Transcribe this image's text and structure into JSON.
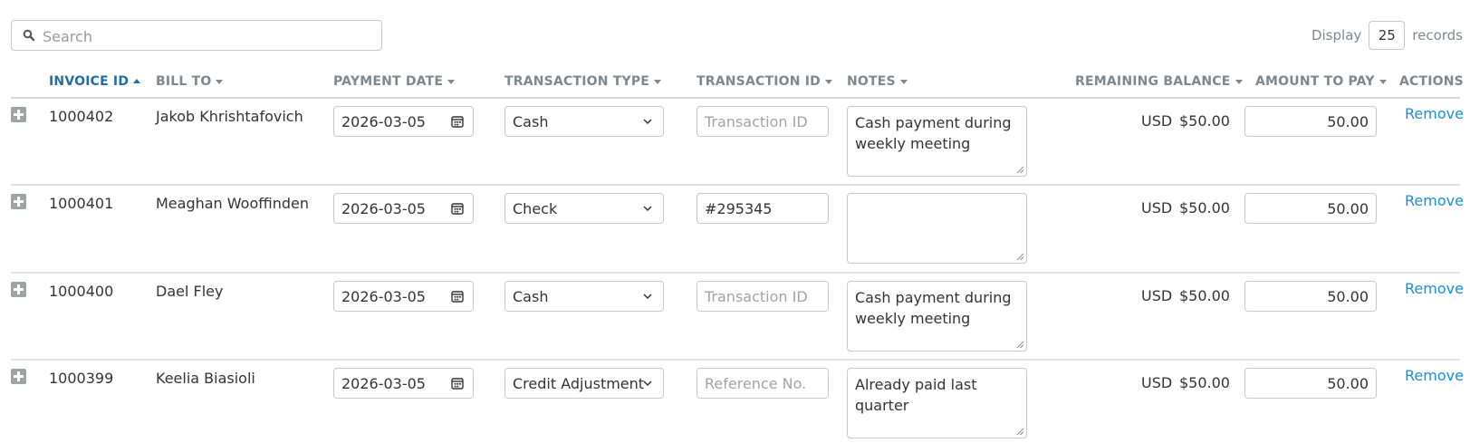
{
  "search": {
    "placeholder": "Search",
    "value": ""
  },
  "display": {
    "prefix": "Display",
    "count": "25",
    "suffix": "records"
  },
  "columns": {
    "invoice_id": "INVOICE ID",
    "bill_to": "BILL TO",
    "payment_date": "PAYMENT DATE",
    "transaction_type": "TRANSACTION TYPE",
    "transaction_id": "TRANSACTION ID",
    "notes": "NOTES",
    "remaining_balance": "REMAINING BALANCE",
    "amount_to_pay": "AMOUNT TO PAY",
    "actions": "ACTIONS"
  },
  "rows": [
    {
      "invoice_id": "1000402",
      "bill_to": "Jakob Khrishtafovich",
      "payment_date": "2026-03-05",
      "transaction_type": "Cash",
      "transaction_id": "",
      "transaction_id_placeholder": "Transaction ID",
      "notes": "Cash payment during weekly meeting",
      "currency": "USD",
      "remaining_balance": "$50.00",
      "amount_to_pay": "50.00",
      "action": "Remove"
    },
    {
      "invoice_id": "1000401",
      "bill_to": "Meaghan Wooffinden",
      "payment_date": "2026-03-05",
      "transaction_type": "Check",
      "transaction_id": "#295345",
      "transaction_id_placeholder": "",
      "notes": "",
      "currency": "USD",
      "remaining_balance": "$50.00",
      "amount_to_pay": "50.00",
      "action": "Remove"
    },
    {
      "invoice_id": "1000400",
      "bill_to": "Dael Fley",
      "payment_date": "2026-03-05",
      "transaction_type": "Cash",
      "transaction_id": "",
      "transaction_id_placeholder": "Transaction ID",
      "notes": "Cash payment during weekly meeting",
      "currency": "USD",
      "remaining_balance": "$50.00",
      "amount_to_pay": "50.00",
      "action": "Remove"
    },
    {
      "invoice_id": "1000399",
      "bill_to": "Keelia Biasioli",
      "payment_date": "2026-03-05",
      "transaction_type": "Credit Adjustment",
      "transaction_id": "",
      "transaction_id_placeholder": "Reference No.",
      "notes": "Already paid last quarter",
      "currency": "USD",
      "remaining_balance": "$50.00",
      "amount_to_pay": "50.00",
      "action": "Remove"
    }
  ]
}
